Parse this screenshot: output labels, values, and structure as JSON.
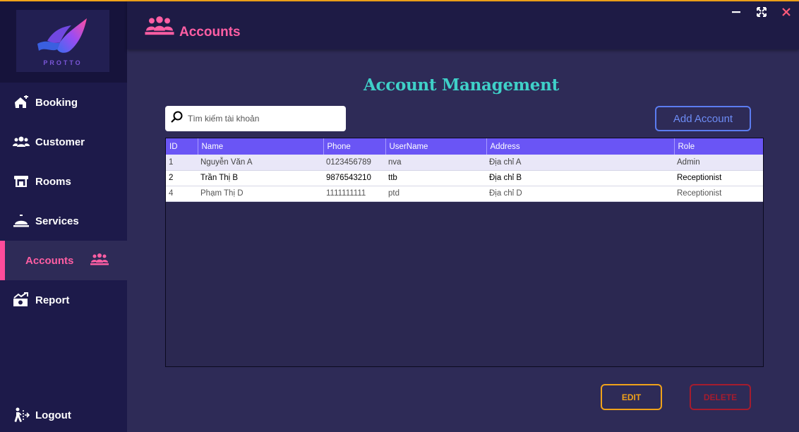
{
  "colors": {
    "accent": "#ff5ea3",
    "header_grid": "#6a55f5",
    "heading": "#3fd0c8",
    "edit": "#f0a21a",
    "delete": "#a51c2e",
    "add": "#5b7cf0"
  },
  "logo": {
    "text": "PROTTO"
  },
  "header": {
    "title": "Accounts",
    "icon": "group-users-icon"
  },
  "window": {
    "minimize_icon": "minimize-icon",
    "maximize_icon": "maximize-icon",
    "close_icon": "close-icon"
  },
  "sidebar": {
    "items": [
      {
        "label": "Booking",
        "icon": "house-plus-icon"
      },
      {
        "label": "Customer",
        "icon": "users-icon"
      },
      {
        "label": "Rooms",
        "icon": "shop-icon"
      },
      {
        "label": "Services",
        "icon": "bell-icon"
      },
      {
        "label": "Accounts",
        "icon": "group-users-icon"
      },
      {
        "label": "Report",
        "icon": "money-chart-icon"
      }
    ],
    "logout": {
      "label": "Logout",
      "icon": "logout-icon"
    }
  },
  "main": {
    "heading": "Account Management",
    "search": {
      "placeholder": "Tìm kiếm tài khoản",
      "value": ""
    },
    "add_button": "Add Account",
    "edit_button": "EDIT",
    "delete_button": "DELETE",
    "table": {
      "columns": [
        "ID",
        "Name",
        "Phone",
        "UserName",
        "Address",
        "Role"
      ],
      "rows": [
        [
          "1",
          "Nguyễn Văn A",
          "0123456789",
          "nva",
          "Địa chỉ A",
          "Admin"
        ],
        [
          "2",
          "Trần Thị B",
          "9876543210",
          "ttb",
          "Địa chỉ B",
          "Receptionist"
        ],
        [
          "4",
          "Phạm Thị D",
          "1111111111",
          "ptd",
          "Địa chỉ D",
          "Receptionist"
        ]
      ]
    }
  }
}
